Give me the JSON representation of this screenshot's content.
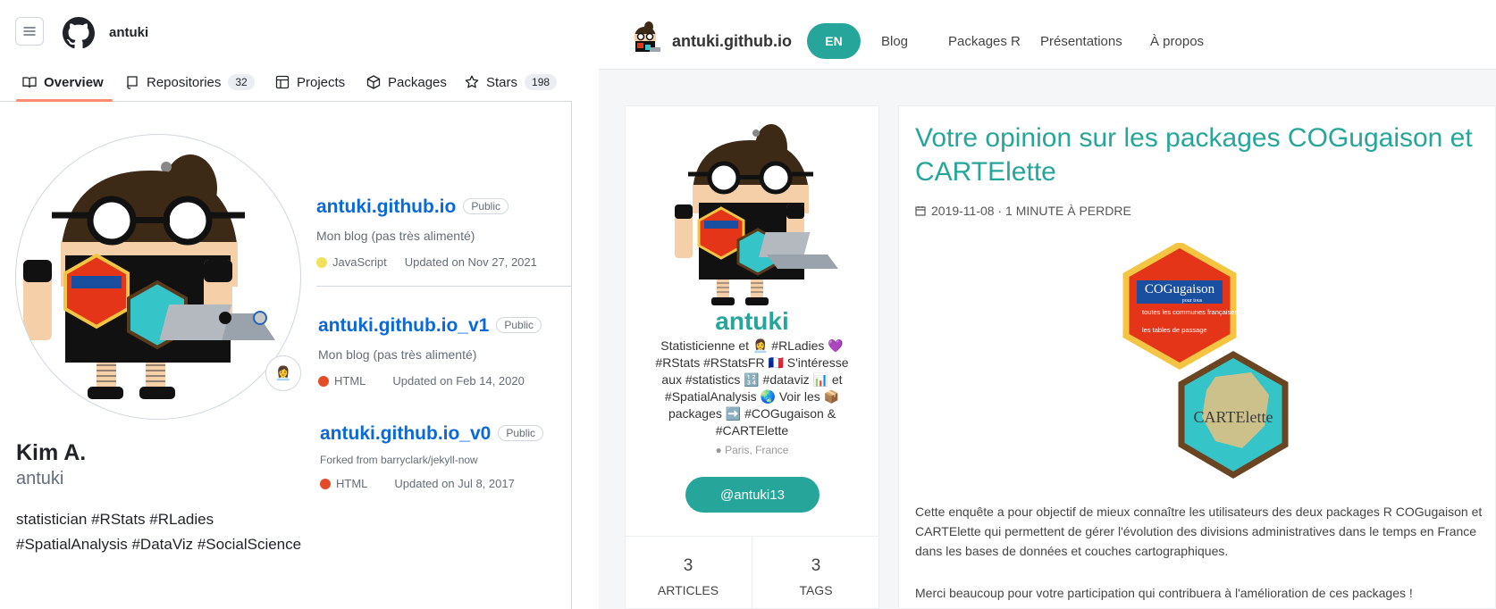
{
  "github": {
    "username": "antuki",
    "tabs": [
      {
        "label": "Overview",
        "count": ""
      },
      {
        "label": "Repositories",
        "count": "32"
      },
      {
        "label": "Projects",
        "count": ""
      },
      {
        "label": "Packages",
        "count": ""
      },
      {
        "label": "Stars",
        "count": "198"
      }
    ],
    "profile": {
      "fullname": "Kim A.",
      "handle": "antuki",
      "bio_line1": "statistician #RStats #RLadies",
      "bio_line2": "#SpatialAnalysis #DataViz #SocialScience",
      "status_emoji": "👩‍💼"
    },
    "repos": [
      {
        "name": "antuki.github.io",
        "visibility": "Public",
        "description": "Mon blog (pas très alimenté)",
        "language": "JavaScript",
        "language_color": "#f1e05a",
        "updated": "Updated on Nov 27, 2021"
      },
      {
        "name": "antuki.github.io_v1",
        "visibility": "Public",
        "description": "Mon blog (pas très alimenté)",
        "language": "HTML",
        "language_color": "#e34c26",
        "updated": "Updated on Feb 14, 2020"
      },
      {
        "name": "antuki.github.io_v0",
        "visibility": "Public",
        "description": "Forked from barryclark/jekyll-now",
        "language": "HTML",
        "language_color": "#e34c26",
        "updated": "Updated on Jul 8, 2017"
      }
    ]
  },
  "blog": {
    "site_name": "antuki.github.io",
    "nav": {
      "lang": "EN",
      "items": [
        "Blog",
        "Packages R",
        "Présentations",
        "À propos"
      ]
    },
    "card": {
      "name": "antuki",
      "bio": "Statisticienne et 👩‍💼 #RLadies 💜 #RStats #RStatsFR 🇫🇷 S'intéresse aux #statistics 🔢 #dataviz 📊 et #SpatialAnalysis 🌏 Voir les 📦 packages ➡️ #COGugaison & #CARTElette",
      "location": "Paris, France",
      "twitter": "@antuki13",
      "stats": [
        {
          "n": "3",
          "label": "ARTICLES"
        },
        {
          "n": "3",
          "label": "TAGS"
        }
      ]
    },
    "post": {
      "title": "Votre opinion sur les packages COGugaison et CARTElette",
      "meta": "2019-11-08 · 1 MINUTE À PERDRE",
      "paragraph1": "Cette enquête a pour objectif de mieux connaître les utilisateurs des deux packages R COGugaison et CARTElette qui permettent de gérer l'évolution des divisions administratives dans le temps en France dans les bases de données et couches cartographiques.",
      "paragraph2": "Merci beaucoup pour votre participation qui contribuera à l'amélioration de ces packages !",
      "hex1": {
        "title": "COGugaison",
        "subtitle": "pour tous",
        "bullets": [
          "toutes les communes françaises",
          "les tables de passage"
        ]
      },
      "hex2": {
        "title": "CARTElette"
      }
    }
  }
}
